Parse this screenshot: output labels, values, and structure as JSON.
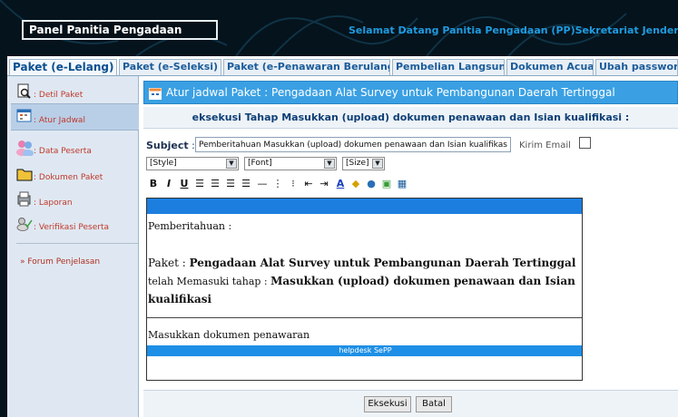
{
  "header": {
    "panel_title": "Panel Panitia Pengadaan",
    "welcome": "Selamat Datang Panitia Pengadaan (PP)Sekretariat Jenderal"
  },
  "tabs": [
    {
      "label": "Paket (e-Lelang)",
      "active": true
    },
    {
      "label": "Paket (e-Seleksi)"
    },
    {
      "label": "Paket (e-Penawaran Berulang)"
    },
    {
      "label": "Pembelian Langsung"
    },
    {
      "label": "Dokumen Acuan"
    },
    {
      "label": "Ubah password"
    }
  ],
  "sidebar": {
    "items": [
      {
        "label": ": Detil Paket",
        "icon": "search-document-icon"
      },
      {
        "label": ": Atur Jadwal",
        "icon": "calendar-icon",
        "active": true
      },
      {
        "label": ": Data Peserta",
        "icon": "users-icon"
      },
      {
        "label": ": Dokumen Paket",
        "icon": "folder-icon"
      },
      {
        "label": ": Laporan",
        "icon": "report-icon"
      },
      {
        "label": ": Verifikasi Peserta",
        "icon": "verify-icon"
      }
    ],
    "forum": "» Forum Penjelasan"
  },
  "main": {
    "title": "Atur jadwal Paket : Pengadaan Alat Survey untuk Pembangunan Daerah Tertinggal",
    "subheading": "eksekusi Tahap Masukkan (upload) dokumen penawaan dan Isian kualifikasi :",
    "subject_label": "Subject",
    "subject_sep": " : ",
    "subject_value": "Pemberitahuan Masukkan (upload) dokumen penawaan dan Isian kualifikasi",
    "kirim_email": "Kirim Email",
    "selects": {
      "style": "[Style]",
      "font": "[Font]",
      "size": "[Size]"
    },
    "editor": {
      "line1": "Pemberitahuan :",
      "paket_prefix": "Paket : ",
      "paket_name": "Pengadaan Alat Survey untuk Pembangunan Daerah Tertinggal",
      "tahap_prefix": "telah Memasuki tahap : ",
      "tahap_name_1": "Masukkan (upload) dokumen penawaan dan Isian",
      "tahap_name_2": "kualifikasi",
      "second_line": "Masukkan dokumen penawaran",
      "helpdesk": "helpdesk SePP"
    },
    "buttons": {
      "eksekusi": "Eksekusi",
      "batal": "Batal"
    }
  },
  "colors": {
    "title_blue": "#3aa0e3",
    "editor_blue": "#1c7fe0",
    "welcome_blue": "#1e9be0",
    "sidebar_bg": "#dfe8f2"
  }
}
